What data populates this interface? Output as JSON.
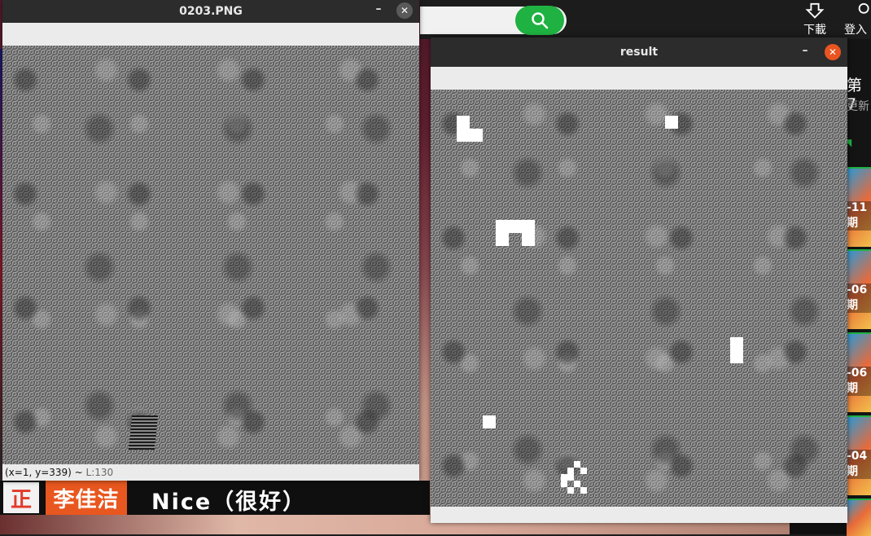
{
  "window_left": {
    "title": "0203.PNG",
    "minimize_glyph": "–",
    "close_glyph": "✕",
    "status": {
      "coords": "(x=1, y=339) ~",
      "level": "L:130"
    }
  },
  "window_right": {
    "title": "result",
    "minimize_glyph": "–",
    "close_glyph": "✕",
    "close_color": "#e95420"
  },
  "site": {
    "header": {
      "download_label": "下載",
      "login_label": "登入",
      "search_icon": "search-icon",
      "accent_color": "#1fb141"
    },
    "sidebar": {
      "title": "第7",
      "update": "更新",
      "thumbs": [
        {
          "label": "-11期"
        },
        {
          "label": "-06期"
        },
        {
          "label": "-06期"
        },
        {
          "label": "-04期"
        }
      ]
    }
  },
  "video": {
    "subtitle_badge": "正",
    "subtitle_name": "李佳洁",
    "subtitle_text": "Nice（很好）"
  }
}
